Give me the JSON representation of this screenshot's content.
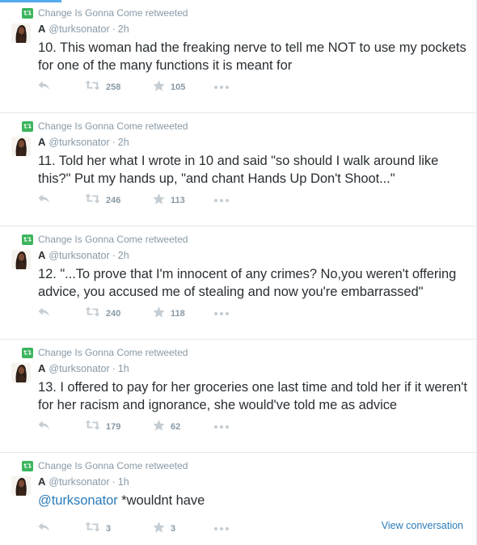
{
  "colors": {
    "accent": "#55acee",
    "link": "#2b7bb9",
    "retweet_green": "#3cb55e",
    "muted": "#8899a6",
    "text": "#292f33",
    "divider": "#e1e8ed"
  },
  "icons": {
    "retweeted": "retweet-badge-icon",
    "reply": "reply-arrow-icon",
    "retweet": "retweet-arrows-icon",
    "favorite": "star-icon",
    "more": "ellipsis-icon"
  },
  "tweets": [
    {
      "retweeted_by": "Change Is Gonna Come retweeted",
      "fullname": "A",
      "handle": "@turksonator",
      "sep": "·",
      "time": "2h",
      "mention": "",
      "text": "10. This woman had the freaking nerve to tell me NOT to use my pockets for one of the many functions it is meant for",
      "retweets": "258",
      "favorites": "105",
      "view_conversation": ""
    },
    {
      "retweeted_by": "Change Is Gonna Come retweeted",
      "fullname": "A",
      "handle": "@turksonator",
      "sep": "·",
      "time": "2h",
      "mention": "",
      "text": "11. Told her what I wrote in 10 and said \"so should I walk around like this?\" Put my hands up, \"and chant Hands Up Don't Shoot...\"",
      "retweets": "246",
      "favorites": "113",
      "view_conversation": ""
    },
    {
      "retweeted_by": "Change Is Gonna Come retweeted",
      "fullname": "A",
      "handle": "@turksonator",
      "sep": "·",
      "time": "2h",
      "mention": "",
      "text": "12. \"...To prove that I'm innocent of any crimes? No,you weren't offering advice, you accused me of stealing and now you're embarrassed\"",
      "retweets": "240",
      "favorites": "118",
      "view_conversation": ""
    },
    {
      "retweeted_by": "Change Is Gonna Come retweeted",
      "fullname": "A",
      "handle": "@turksonator",
      "sep": "·",
      "time": "1h",
      "mention": "",
      "text": "13. I offered to pay for her groceries one last time and told her if it weren't for her racism and ignorance, she would've told me as advice",
      "retweets": "179",
      "favorites": "62",
      "view_conversation": ""
    },
    {
      "retweeted_by": "Change Is Gonna Come retweeted",
      "fullname": "A",
      "handle": "@turksonator",
      "sep": "·",
      "time": "1h",
      "mention": "@turksonator",
      "text": " *wouldnt have",
      "retweets": "3",
      "favorites": "3",
      "view_conversation": "View conversation"
    }
  ]
}
